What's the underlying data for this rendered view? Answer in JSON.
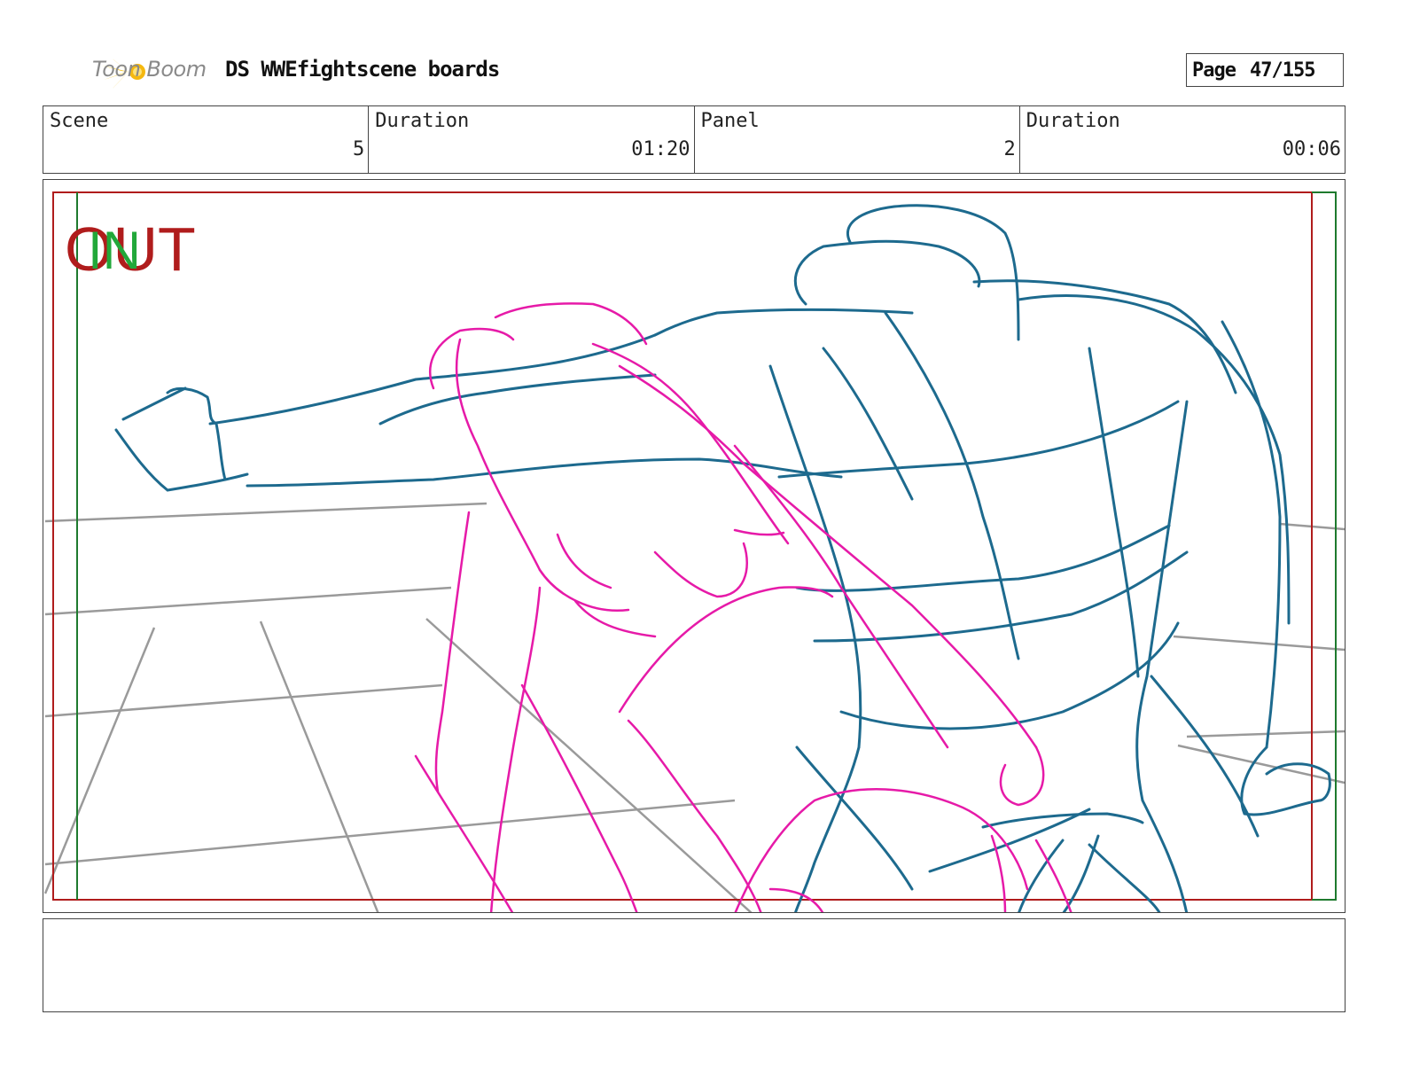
{
  "header": {
    "logo_text": "Toon Boom",
    "title": "DS WWEfightscene boards",
    "page_label": "Page",
    "page_value": "47/155"
  },
  "info": {
    "scene_label": "Scene",
    "scene_value": "5",
    "scene_duration_label": "Duration",
    "scene_duration_value": "01:20",
    "panel_label": "Panel",
    "panel_value": "2",
    "panel_duration_label": "Duration",
    "panel_duration_value": "00:06"
  },
  "panel": {
    "out_marker": "OUT",
    "in_marker": "IN",
    "colors": {
      "out_frame": "#b01c1c",
      "in_frame": "#1e7a2e",
      "figure_a": "#e61aa8",
      "figure_b": "#1d6a8e",
      "ring": "#9a9a9a"
    }
  },
  "notes": {
    "text": ""
  }
}
